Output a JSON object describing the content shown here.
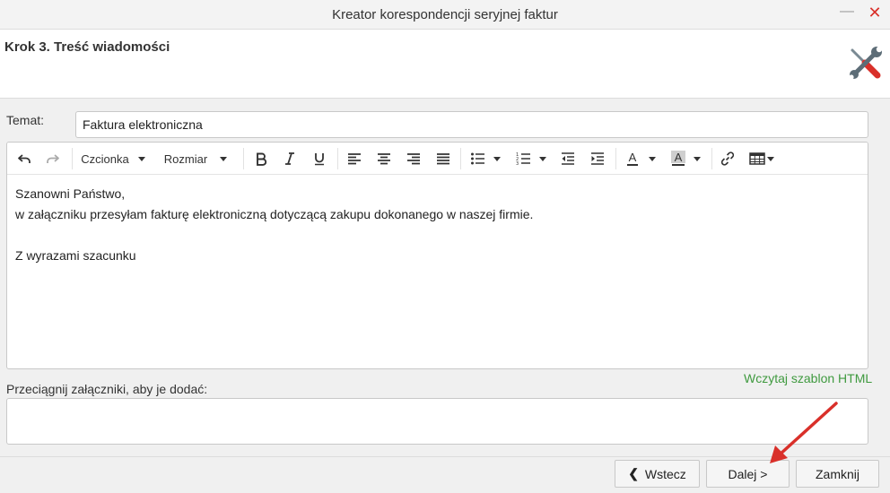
{
  "window": {
    "title": "Kreator korespondencji seryjnej faktur",
    "minimize_glyph": "—",
    "close_glyph": "✕"
  },
  "header": {
    "step_title": "Krok 3. Treść wiadomości",
    "icon": "tools-icon"
  },
  "subject": {
    "label": "Temat:",
    "value": "Faktura elektroniczna"
  },
  "toolbar": {
    "font_label": "Czcionka",
    "size_label": "Rozmiar"
  },
  "editor": {
    "lines": [
      "Szanowni Państwo,",
      "w załączniku przesyłam fakturę elektroniczną dotyczącą zakupu dokonanego w naszej firmie.",
      "",
      "Z wyrazami szacunku"
    ]
  },
  "links": {
    "load_template": "Wczytaj szablon HTML"
  },
  "attachments": {
    "label": "Przeciągnij załączniki, aby je dodać:"
  },
  "buttons": {
    "back": "Wstecz",
    "back_glyph": "❮",
    "next": "Dalej >",
    "close": "Zamknij"
  },
  "colors": {
    "accent_green": "#3f9a3f",
    "close_red": "#d9302a",
    "arrow_red": "#d9302a"
  }
}
